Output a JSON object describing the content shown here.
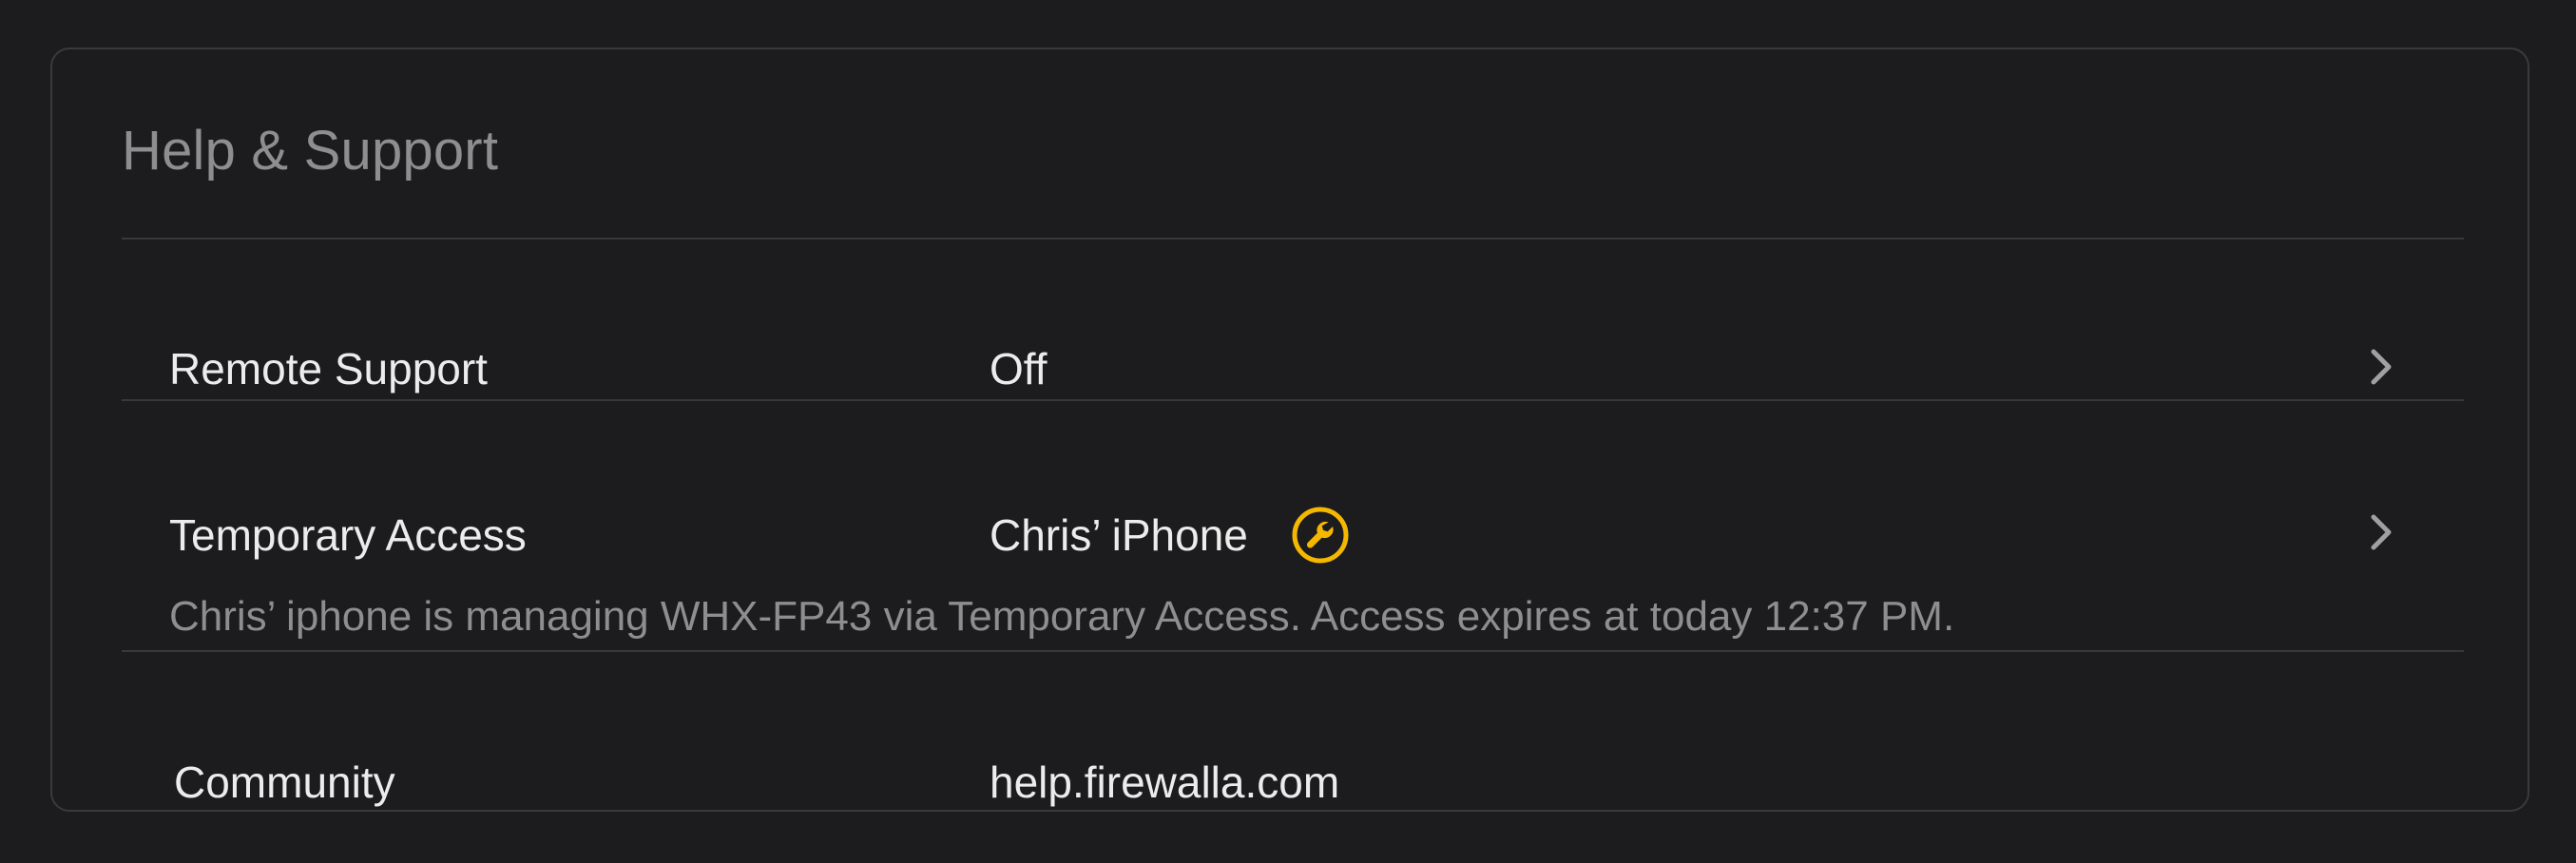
{
  "section": {
    "title": "Help & Support"
  },
  "rows": [
    {
      "label": "Remote Support",
      "value": "Off",
      "chevron_icon": "chevron-right-icon"
    },
    {
      "label": "Temporary Access",
      "value": "Chris’ iPhone",
      "status_icon": "wrench-icon",
      "description": "Chris’ iphone is managing WHX-FP43 via Temporary Access. Access expires at today 12:37 PM.",
      "chevron_icon": "chevron-right-icon"
    },
    {
      "label": "Community",
      "value": "help.firewalla.com"
    }
  ],
  "colors": {
    "background": "#1c1c1e",
    "border": "#3a3a3c",
    "accent_icon": "#f5b800",
    "secondary_text": "#8e8e90",
    "primary_text": "#ececec"
  }
}
